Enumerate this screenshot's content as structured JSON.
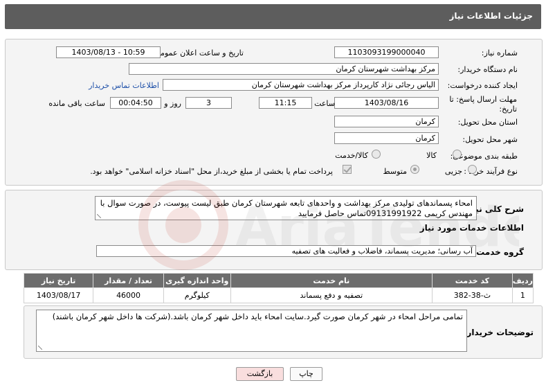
{
  "header": {
    "title": "جزئیات اطلاعات نیاز"
  },
  "fields": {
    "need_number_label": "شماره نیاز:",
    "need_number": "1103093199000040",
    "announce_label": "تاریخ و ساعت اعلان عمومی:",
    "announce_value": "1403/08/13 - 10:59",
    "buyer_org_label": "نام دستگاه خریدار:",
    "buyer_org": "مرکز بهداشت شهرستان کرمان",
    "requester_label": "ایجاد کننده درخواست:",
    "requester": "الیاس رجائی نژاد کارپرداز مرکز بهداشت شهرستان کرمان",
    "contact_link": "اطلاعات تماس خریدار",
    "deadline_label": "مهلت ارسال پاسخ: تا",
    "deadline_label2": "تاریخ:",
    "deadline_date": "1403/08/16",
    "time_label": "ساعت",
    "deadline_time": "11:15",
    "days_value": "3",
    "days_label": "روز و",
    "remaining_time": "00:04:50",
    "remaining_label": "ساعت باقی مانده",
    "province_label": "استان محل تحویل:",
    "province": "کرمان",
    "city_label": "شهر محل تحویل:",
    "city": "کرمان",
    "category_label": "طبقه بندی موضوعی:",
    "category_options": [
      "کالا",
      "کالا/خدمت"
    ],
    "process_label": "نوع فرآیند خرید :",
    "process_options": [
      "جزیی",
      "متوسط"
    ],
    "payment_note": "پرداخت تمام یا بخشی از مبلغ خرید،از محل \"اسناد خزانه اسلامی\" خواهد بود."
  },
  "summary": {
    "label": "شرح کلی نیاز:",
    "text": "امحاء پسماندهای تولیدی مرکز بهداشت و واحدهای تابعه شهرستان کرمان طبق لیست پیوست، در صورت سوال با مهندس کریمی 09131991922تماس حاصل فرمایید"
  },
  "services": {
    "section_title": "اطلاعات خدمات مورد نیاز",
    "group_label": "گروه خدمت:",
    "group_value": "آب رسانی؛ مدیریت پسماند، فاضلاب و فعالیت های تصفیه",
    "columns": [
      "ردیف",
      "کد خدمت",
      "نام خدمت",
      "واحد اندازه گیری",
      "تعداد / مقدار",
      "تاریخ نیاز"
    ],
    "rows": [
      [
        "1",
        "ث-38-382",
        "تصفیه و دفع پسماند",
        "کیلوگرم",
        "46000",
        "1403/08/17"
      ]
    ]
  },
  "buyer_notes": {
    "label": "توضیحات خریدار:",
    "text": "تمامی مراحل امحاء در شهر کرمان صورت گیرد.سایت امحاء باید داخل شهر کرمان باشد.(شرکت ها داخل شهر کرمان باشند)"
  },
  "buttons": {
    "print": "چاپ",
    "back": "بازگشت"
  },
  "watermark": {
    "text": "AriaTender.neT"
  },
  "colors": {
    "header_bg": "#5d5d5d",
    "link": "#1d4fa8",
    "back_button_bg": "#f9dede"
  }
}
